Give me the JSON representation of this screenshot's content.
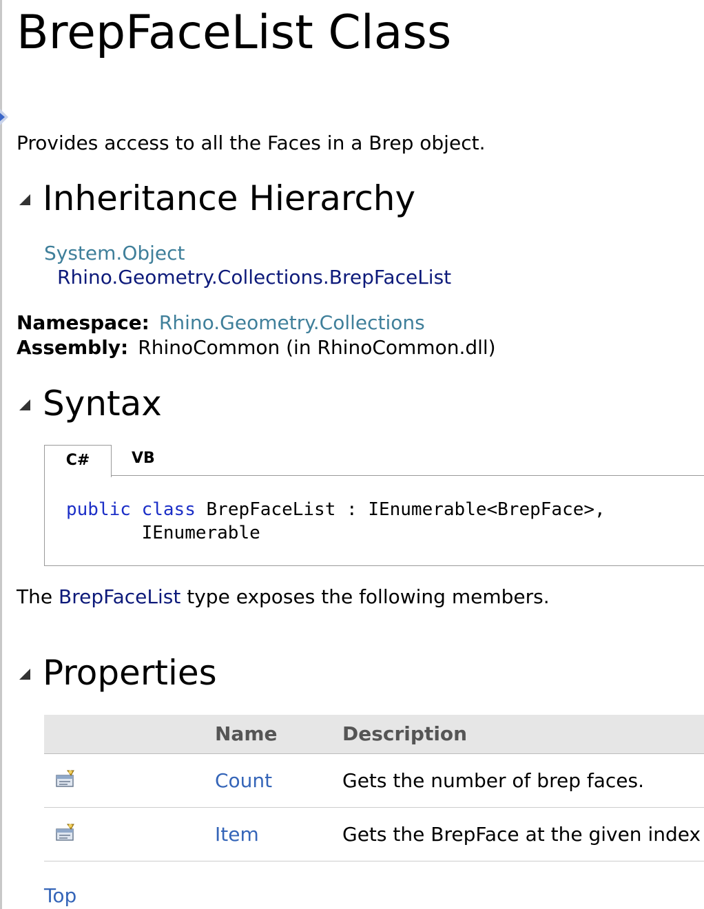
{
  "title": "BrepFaceList Class",
  "summary": "Provides access to all the Faces in a Brep object.",
  "inheritance": {
    "heading": "Inheritance Hierarchy",
    "parent": "System.Object",
    "current": "Rhino.Geometry.Collections.BrepFaceList"
  },
  "namespace": {
    "label": "Namespace:",
    "value": "Rhino.Geometry.Collections"
  },
  "assembly": {
    "label": "Assembly:",
    "value": "RhinoCommon (in RhinoCommon.dll)"
  },
  "syntax": {
    "heading": "Syntax",
    "tabs": [
      "C#",
      "VB"
    ],
    "code": {
      "kw1": "public",
      "kw2": "class",
      "line1_rest": " BrepFaceList : IEnumerable<BrepFace>,",
      "line2": "IEnumerable"
    }
  },
  "members_intro": {
    "before": "The ",
    "link": "BrepFaceList",
    "after": " type exposes the following members."
  },
  "properties": {
    "heading": "Properties",
    "columns": [
      "Name",
      "Description"
    ],
    "rows": [
      {
        "icon": "public-property-icon",
        "name": "Count",
        "description": "Gets the number of brep faces."
      },
      {
        "icon": "public-property-icon",
        "name": "Item",
        "description": "Gets the BrepFace at the given index"
      }
    ]
  },
  "top_link": "Top"
}
